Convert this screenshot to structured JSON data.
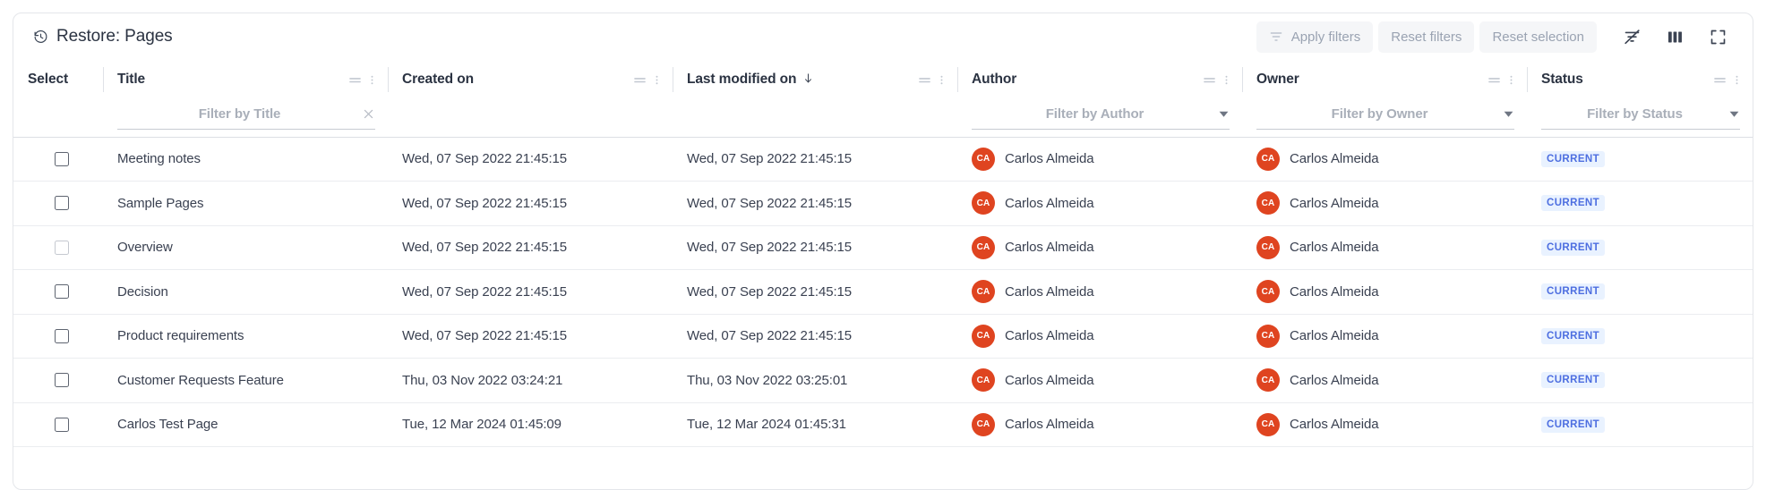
{
  "panel": {
    "title": "Restore: Pages",
    "title_icon": "history-clock-icon"
  },
  "toolbar": {
    "apply_filters_label": "Apply filters",
    "reset_filters_label": "Reset filters",
    "reset_selection_label": "Reset selection",
    "icons": [
      {
        "name": "filter-off-icon"
      },
      {
        "name": "columns-icon"
      },
      {
        "name": "fullscreen-icon"
      }
    ]
  },
  "table": {
    "columns": [
      {
        "key": "select",
        "label": "Select",
        "filter_placeholder": null,
        "filter_type": "none",
        "sorted": null,
        "has_tools": false
      },
      {
        "key": "title",
        "label": "Title",
        "filter_placeholder": "Filter by Title",
        "filter_type": "text",
        "sorted": null,
        "has_tools": true
      },
      {
        "key": "created",
        "label": "Created on",
        "filter_placeholder": null,
        "filter_type": "none",
        "sorted": null,
        "has_tools": true
      },
      {
        "key": "lastmod",
        "label": "Last modified on",
        "filter_placeholder": null,
        "filter_type": "none",
        "sorted": "desc",
        "has_tools": true
      },
      {
        "key": "author",
        "label": "Author",
        "filter_placeholder": "Filter by Author",
        "filter_type": "select",
        "sorted": null,
        "has_tools": true
      },
      {
        "key": "owner",
        "label": "Owner",
        "filter_placeholder": "Filter by Owner",
        "filter_type": "select",
        "sorted": null,
        "has_tools": true
      },
      {
        "key": "status",
        "label": "Status",
        "filter_placeholder": "Filter by Status",
        "filter_type": "select",
        "sorted": null,
        "has_tools": true
      }
    ],
    "sort_indicator": "↓",
    "rows": [
      {
        "selected": false,
        "checkbox_state": "normal",
        "title": "Meeting notes",
        "created": "Wed, 07 Sep 2022 21:45:15",
        "lastmod": "Wed, 07 Sep 2022 21:45:15",
        "author": "Carlos Almeida",
        "author_initials": "CA",
        "owner": "Carlos Almeida",
        "owner_initials": "CA",
        "status": "CURRENT"
      },
      {
        "selected": false,
        "checkbox_state": "normal",
        "title": "Sample Pages",
        "created": "Wed, 07 Sep 2022 21:45:15",
        "lastmod": "Wed, 07 Sep 2022 21:45:15",
        "author": "Carlos Almeida",
        "author_initials": "CA",
        "owner": "Carlos Almeida",
        "owner_initials": "CA",
        "status": "CURRENT"
      },
      {
        "selected": false,
        "checkbox_state": "faded",
        "title": "Overview",
        "created": "Wed, 07 Sep 2022 21:45:15",
        "lastmod": "Wed, 07 Sep 2022 21:45:15",
        "author": "Carlos Almeida",
        "author_initials": "CA",
        "owner": "Carlos Almeida",
        "owner_initials": "CA",
        "status": "CURRENT"
      },
      {
        "selected": false,
        "checkbox_state": "normal",
        "title": "Decision",
        "created": "Wed, 07 Sep 2022 21:45:15",
        "lastmod": "Wed, 07 Sep 2022 21:45:15",
        "author": "Carlos Almeida",
        "author_initials": "CA",
        "owner": "Carlos Almeida",
        "owner_initials": "CA",
        "status": "CURRENT"
      },
      {
        "selected": false,
        "checkbox_state": "normal",
        "title": "Product requirements",
        "created": "Wed, 07 Sep 2022 21:45:15",
        "lastmod": "Wed, 07 Sep 2022 21:45:15",
        "author": "Carlos Almeida",
        "author_initials": "CA",
        "owner": "Carlos Almeida",
        "owner_initials": "CA",
        "status": "CURRENT"
      },
      {
        "selected": false,
        "checkbox_state": "normal",
        "title": "Customer Requests Feature",
        "created": "Thu, 03 Nov 2022 03:24:21",
        "lastmod": "Thu, 03 Nov 2022 03:25:01",
        "author": "Carlos Almeida",
        "author_initials": "CA",
        "owner": "Carlos Almeida",
        "owner_initials": "CA",
        "status": "CURRENT"
      },
      {
        "selected": false,
        "checkbox_state": "normal",
        "title": "Carlos Test Page",
        "created": "Tue, 12 Mar 2024 01:45:09",
        "lastmod": "Tue, 12 Mar 2024 01:45:31",
        "author": "Carlos Almeida",
        "author_initials": "CA",
        "owner": "Carlos Almeida",
        "owner_initials": "CA",
        "status": "CURRENT"
      }
    ]
  },
  "colors": {
    "avatar": "#df4420",
    "badge_text": "#4d6ee0",
    "badge_bg": "#e9f2ff",
    "toolbar_button_bg": "#f5f6f8",
    "toolbar_button_text": "#9aa3b2",
    "card_border": "#e4e6ea",
    "row_divider": "#ebedf0"
  }
}
